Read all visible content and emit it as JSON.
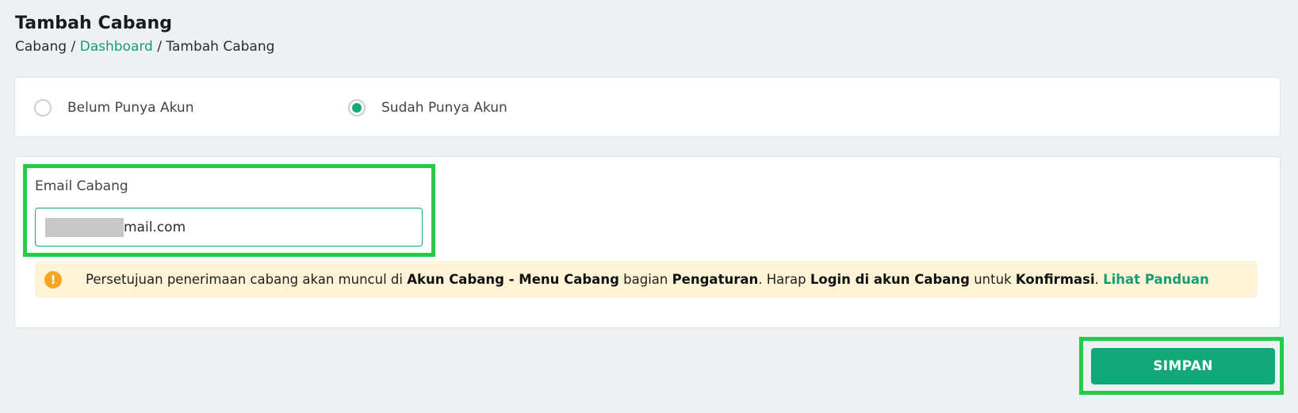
{
  "header": {
    "title": "Tambah Cabang",
    "breadcrumb": [
      "Cabang",
      "Dashboard",
      "Tambah Cabang"
    ],
    "separator": "/"
  },
  "account_type": {
    "options": [
      "Belum Punya Akun",
      "Sudah Punya Akun"
    ],
    "selected": "Sudah Punya Akun"
  },
  "form": {
    "email_label": "Email Cabang",
    "email_visible_value": "mail.com",
    "email_redacted": true
  },
  "alert": {
    "icon": "exclamation-icon",
    "text_1": "Persetujuan penerimaan cabang akan muncul di ",
    "bold_1": "Akun Cabang - Menu Cabang",
    "text_2": " bagian ",
    "bold_2": "Pengaturan",
    "text_3": ". Harap ",
    "bold_3": "Login di akun Cabang",
    "text_4": " untuk ",
    "bold_4": "Konfirmasi",
    "text_5": ". ",
    "link": "Lihat Panduan"
  },
  "actions": {
    "save_label": "SIMPAN"
  },
  "colors": {
    "accent": "#12a877",
    "highlight": "#22cc44",
    "alert_bg": "#fdf3d6",
    "alert_icon": "#f5a623"
  }
}
